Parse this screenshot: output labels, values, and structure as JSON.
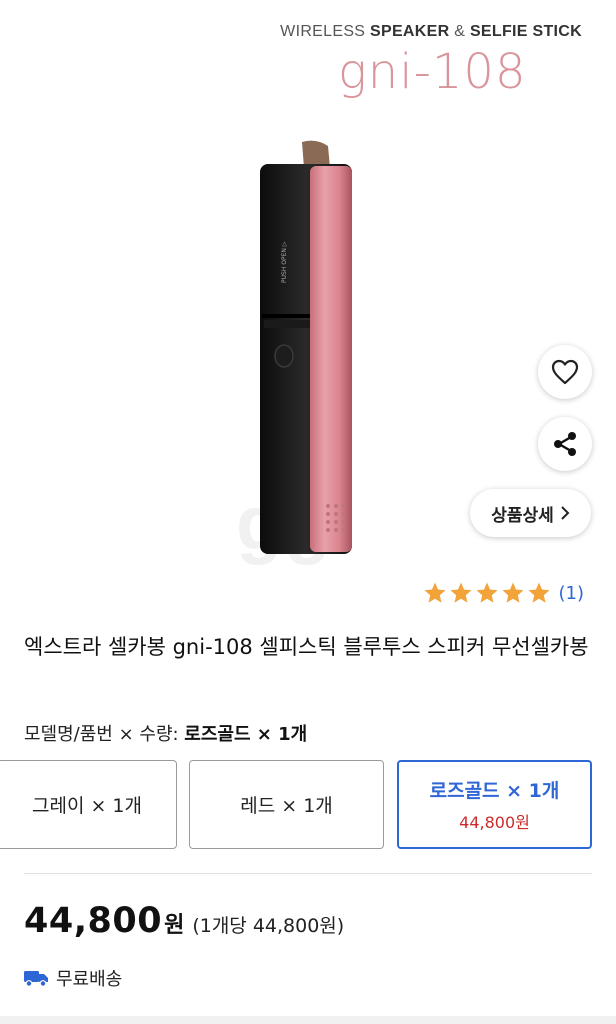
{
  "hero": {
    "brand_prefix": "WIRELESS ",
    "brand_bold": "SPEAKER",
    "brand_mid": " & ",
    "brand_bold2": "SELFIE STICK",
    "model_name": "gni-108",
    "device_text": "PUSH OPEN ▷",
    "watermark": "gg",
    "wish_icon": "heart-icon",
    "share_icon": "share-icon",
    "detail_label": "상품상세",
    "detail_icon": "chevron-right-icon"
  },
  "rating": {
    "stars": 5,
    "count_label": "(1)",
    "star_color": "#f2a33a"
  },
  "product": {
    "title": "엑스트라 셀카봉 gni-108 셀피스틱 블루투스 스피커 무선셀카봉"
  },
  "options": {
    "label": "모델명/품번 × 수량: ",
    "selected_summary": "로즈골드 × 1개",
    "items": [
      {
        "name": "그레이 × 1개",
        "price": ""
      },
      {
        "name": "레드 × 1개",
        "price": ""
      },
      {
        "name": "로즈골드 × 1개",
        "price": "44,800원",
        "selected": true
      }
    ],
    "accent_color": "#2f66d6"
  },
  "price": {
    "amount": "44,800",
    "unit": "원",
    "per_unit": "(1개당 44,800원)"
  },
  "shipping": {
    "icon": "truck-icon",
    "label": "무료배송"
  }
}
